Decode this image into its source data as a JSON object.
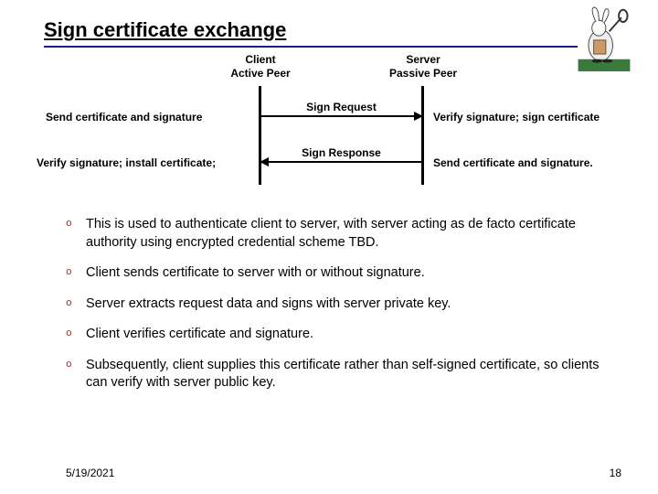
{
  "title": "Sign certificate exchange",
  "diagram": {
    "client_label_line1": "Client",
    "client_label_line2": "Active Peer",
    "server_label_line1": "Server",
    "server_label_line2": "Passive Peer",
    "msg_request": "Sign Request",
    "msg_response": "Sign Response",
    "note_client_send": "Send certificate and signature",
    "note_server_verify": "Verify signature; sign certificate",
    "note_client_verify": "Verify signature; install certificate;",
    "note_server_send": "Send certificate and signature."
  },
  "bullets": [
    "This is used to authenticate client to server, with server acting as de facto certificate authority using encrypted credential scheme TBD.",
    "Client sends certificate to server with or without signature.",
    "Server extracts request data and signs with server private key.",
    "Client verifies certificate and signature.",
    "Subsequently, client supplies this certificate rather than self-signed certificate, so clients can verify with server public key."
  ],
  "footer": {
    "date": "5/19/2021",
    "page": "18"
  }
}
